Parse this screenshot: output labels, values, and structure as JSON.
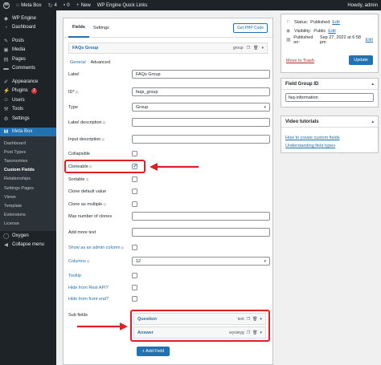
{
  "admin_bar": {
    "site_name": "Meta Box",
    "updates_count": "4",
    "comments_count": "0",
    "new_label": "New",
    "engine_label": "WP Engine Quick Links",
    "greeting": "Howdy, admin"
  },
  "sidebar": {
    "top_items": [
      {
        "label": "WP Engine",
        "icon": "engine-icon"
      },
      {
        "label": "Dashboard",
        "icon": "dashboard-icon"
      }
    ],
    "items": [
      {
        "label": "Posts",
        "icon": "pin-icon"
      },
      {
        "label": "Media",
        "icon": "media-icon"
      },
      {
        "label": "Pages",
        "icon": "pages-icon"
      },
      {
        "label": "Comments",
        "icon": "comments-icon"
      }
    ],
    "items2": [
      {
        "label": "Appearance",
        "icon": "brush-icon"
      },
      {
        "label": "Plugins",
        "icon": "plugin-icon",
        "badge": "2"
      },
      {
        "label": "Users",
        "icon": "users-icon"
      },
      {
        "label": "Tools",
        "icon": "tools-icon"
      },
      {
        "label": "Settings",
        "icon": "settings-icon"
      }
    ],
    "active_item": {
      "label": "Meta Box",
      "icon": "metabox-icon"
    },
    "submenu": [
      "Dashboard",
      "Post Types",
      "Taxonomies",
      "Custom Fields",
      "Relationships",
      "Settings Pages",
      "Views",
      "Template",
      "Extensions",
      "License"
    ],
    "current_submenu": "Custom Fields",
    "bottom_items": [
      {
        "label": "Oxygen",
        "icon": "oxygen-icon"
      },
      {
        "label": "Collapse menu",
        "icon": "collapse-icon"
      }
    ]
  },
  "editor": {
    "tabs": [
      "Fields",
      "Settings"
    ],
    "active_tab": "Fields",
    "get_php_label": "Get PHP Code",
    "group": {
      "title": "FAQs Group",
      "type": "group"
    },
    "subtabs": [
      "General",
      "Advanced"
    ],
    "fields": {
      "label": {
        "label": "Label",
        "value": "FAQs Group"
      },
      "id": {
        "label": "ID*",
        "value": "faqs_group"
      },
      "type": {
        "label": "Type",
        "value": "Group"
      },
      "label_description": {
        "label": "Label description"
      },
      "input_description": {
        "label": "Input description"
      },
      "collapsible": {
        "label": "Collapsible"
      },
      "cloneable": {
        "label": "Cloneable"
      },
      "sortable": {
        "label": "Sortable"
      },
      "clone_default": {
        "label": "Clone default value"
      },
      "clone_multiple": {
        "label": "Clone as multiple"
      },
      "max_clones": {
        "label": "Max number of clones"
      },
      "add_more": {
        "label": "Add more text"
      },
      "admin_column": {
        "label": "Show as an admin column"
      },
      "columns": {
        "label": "Columns",
        "value": "12"
      },
      "tooltip": {
        "label": "Tooltip"
      },
      "hide_rest": {
        "label": "Hide from Rest API?"
      },
      "hide_front": {
        "label": "Hide from front end?"
      },
      "sub_fields": {
        "label": "Sub fields"
      }
    },
    "sub_fields": [
      {
        "name": "Question",
        "type": "text"
      },
      {
        "name": "Answer",
        "type": "wysiwyg"
      }
    ],
    "add_field_label": "+ Add Field"
  },
  "publish": {
    "status_label": "Status:",
    "status_value": "Published",
    "visibility_label": "Visibility:",
    "visibility_value": "Public",
    "published_label": "Published on:",
    "published_value": "Sep 27, 2022 at 6:58 pm",
    "edit_label": "Edit",
    "trash_label": "Move to Trash",
    "update_label": "Update"
  },
  "field_group_id": {
    "title": "Field Group ID",
    "value": "faq-information"
  },
  "video": {
    "title": "Video tutorials",
    "links": [
      "How to create custom fields",
      "Understanding field types"
    ]
  },
  "colors": {
    "accent": "#2271b1",
    "highlight": "#e01f26",
    "sidebar": "#1d2327"
  }
}
